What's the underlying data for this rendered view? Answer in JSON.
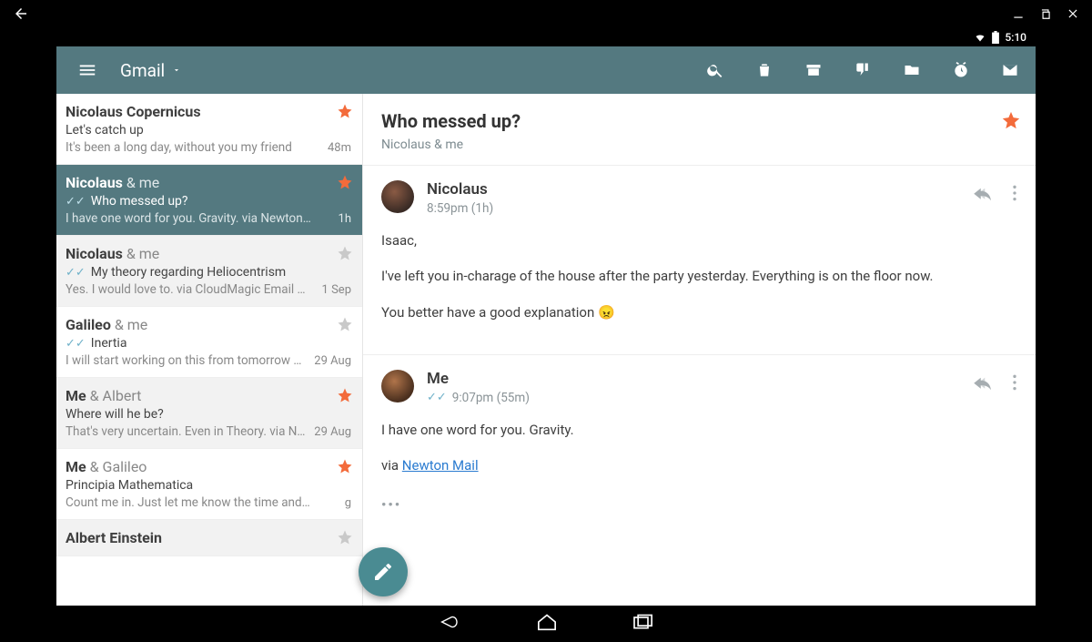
{
  "status": {
    "time": "5:10"
  },
  "header": {
    "account_label": "Gmail"
  },
  "threads": [
    {
      "from": "Nicolaus Copernicus",
      "amp": "",
      "subject": "Let's catch up",
      "preview": "It's been a long day, without you my friend",
      "time": "48m",
      "starred": true,
      "selected": false,
      "shaded": false,
      "checks": false
    },
    {
      "from": "Nicolaus",
      "amp": " & me",
      "subject": "Who messed up?",
      "preview": "I have one word for you. Gravity. via Newton…",
      "time": "1h",
      "starred": true,
      "selected": true,
      "shaded": false,
      "checks": true
    },
    {
      "from": "Nicolaus",
      "amp": " & me",
      "subject": "My theory regarding Heliocentrism",
      "preview": "Yes. I would love to. via CloudMagic Email O…",
      "time": "1 Sep",
      "starred": false,
      "selected": false,
      "shaded": true,
      "checks": true
    },
    {
      "from": "Galileo",
      "amp": " & me",
      "subject": "Inertia",
      "preview": "I will start working on this from tomorrow m…",
      "time": "29 Aug",
      "starred": false,
      "selected": false,
      "shaded": false,
      "checks": true
    },
    {
      "from": "Me",
      "amp": " & Albert",
      "subject": "Where will he be?",
      "preview": "That's very uncertain. Even in Theory. via Ne…",
      "time": "29 Aug",
      "starred": true,
      "selected": false,
      "shaded": true,
      "checks": false
    },
    {
      "from": "Me",
      "amp": " & Galileo",
      "subject": "Principia Mathematica",
      "preview": "Count me in. Just let me know the time and…",
      "time": "g",
      "starred": true,
      "selected": false,
      "shaded": false,
      "checks": false
    },
    {
      "from": "Albert Einstein",
      "amp": "",
      "subject": "",
      "preview": "",
      "time": "",
      "starred": false,
      "selected": false,
      "shaded": true,
      "checks": false
    }
  ],
  "detail": {
    "subject": "Who messed up?",
    "participants": "Nicolaus & me",
    "starred": true,
    "messages": [
      {
        "from": "Nicolaus",
        "meta": "8:59pm (1h)",
        "checks": false,
        "avatar": "n",
        "body_lines": [
          "Isaac,",
          "I've left you in-charage of the house after the party yesterday. Everything is on the floor now.",
          "You better have a good explanation 😠"
        ],
        "link_label": ""
      },
      {
        "from": "Me",
        "meta": "9:07pm (55m)",
        "checks": true,
        "avatar": "m",
        "body_lines": [
          "I have one word for you. Gravity."
        ],
        "via_prefix": "via ",
        "link_label": "Newton Mail"
      }
    ]
  }
}
